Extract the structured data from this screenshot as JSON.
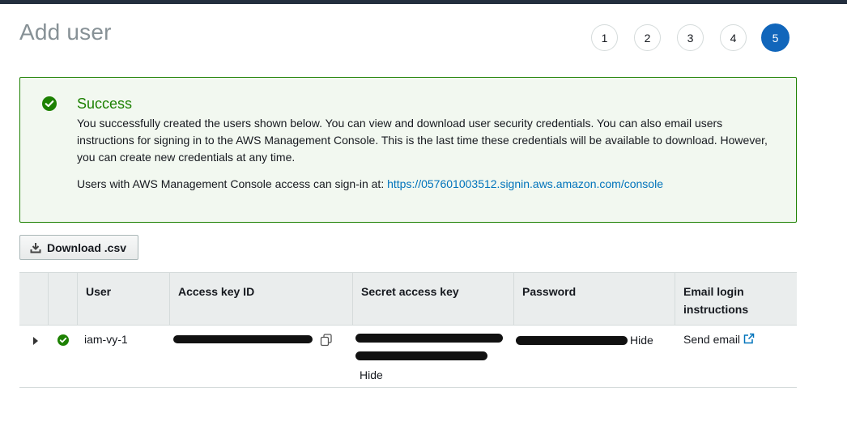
{
  "page": {
    "title": "Add user"
  },
  "wizard": {
    "steps": [
      "1",
      "2",
      "3",
      "4",
      "5"
    ],
    "active_step": "5"
  },
  "alert": {
    "icon": "check-circle-icon",
    "title": "Success",
    "body": "You successfully created the users shown below. You can view and download user security credentials. You can also email users instructions for signing in to the AWS Management Console. This is the last time these credentials will be available to download. However, you can create new credentials at any time.",
    "signin_text": "Users with AWS Management Console access can sign-in at: ",
    "signin_url": "https://057601003512.signin.aws.amazon.com/console"
  },
  "download_button": {
    "label": "Download .csv",
    "icon": "download-icon"
  },
  "table": {
    "headers": {
      "user": "User",
      "access_key_id": "Access key ID",
      "secret_access_key": "Secret access key",
      "password": "Password",
      "email_login": "Email login instructions"
    },
    "rows": [
      {
        "user": "iam-vy-1",
        "status": "success",
        "password_hide": "Hide",
        "secret_hide": "Hide",
        "send_email": "Send email"
      }
    ]
  },
  "colors": {
    "success": "#1d8102",
    "link": "#0073bb",
    "active_step": "#1166bb",
    "header_bg": "#eaeded"
  }
}
